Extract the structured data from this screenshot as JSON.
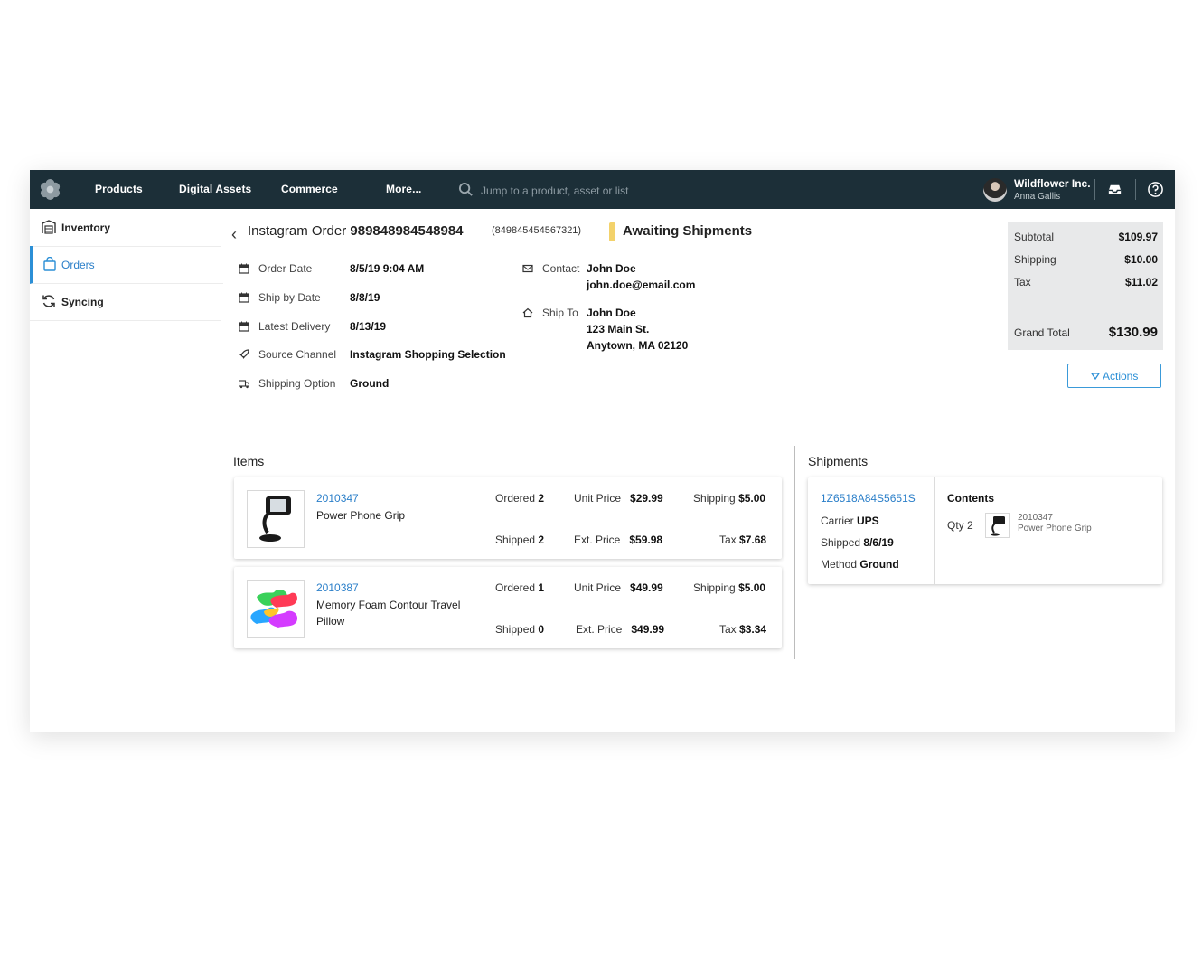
{
  "topbar": {
    "nav": [
      "Products",
      "Digital Assets",
      "Commerce",
      "More..."
    ],
    "search_placeholder": "Jump to a product, asset or list",
    "org_name": "Wildflower Inc.",
    "user_name": "Anna Gallis"
  },
  "sidebar": {
    "items": [
      {
        "label": "Inventory",
        "icon": "warehouse-icon",
        "active": false
      },
      {
        "label": "Orders",
        "icon": "shopping-bag-icon",
        "active": true
      },
      {
        "label": "Syncing",
        "icon": "sync-icon",
        "active": false
      }
    ]
  },
  "order": {
    "title_prefix": "Instagram Order",
    "number": "989848984548984",
    "alt_number": "(849845454567321)",
    "status": "Awaiting Shipments",
    "status_color": "#f3d26b",
    "details": [
      {
        "label": "Order Date",
        "value": "8/5/19 9:04 AM",
        "icon": "calendar-icon"
      },
      {
        "label": "Ship by Date",
        "value": "8/8/19",
        "icon": "calendar-icon"
      },
      {
        "label": "Latest Delivery",
        "value": "8/13/19",
        "icon": "calendar-icon"
      },
      {
        "label": "Source Channel",
        "value": "Instagram Shopping Selection",
        "icon": "rocket-icon"
      },
      {
        "label": "Shipping Option",
        "value": "Ground",
        "icon": "truck-icon"
      }
    ],
    "contact": {
      "label": "Contact",
      "name": "John Doe",
      "email": "john.doe@email.com"
    },
    "ship_to": {
      "label": "Ship To",
      "name": "John Doe",
      "address1": "123 Main St.",
      "address2": "Anytown, MA 02120"
    }
  },
  "summary": {
    "subtotal_label": "Subtotal",
    "subtotal": "$109.97",
    "shipping_label": "Shipping",
    "shipping": "$10.00",
    "tax_label": "Tax",
    "tax": "$11.02",
    "grand_total_label": "Grand Total",
    "grand_total": "$130.99"
  },
  "actions_label": "Actions",
  "items_title": "Items",
  "items": [
    {
      "sku": "2010347",
      "name": "Power Phone Grip",
      "ordered_label": "Ordered",
      "ordered": "2",
      "shipped_label": "Shipped",
      "shipped": "2",
      "unit_price_label": "Unit Price",
      "unit_price": "$29.99",
      "ext_price_label": "Ext. Price",
      "ext_price": "$59.98",
      "shipping_label": "Shipping",
      "shipping": "$5.00",
      "tax_label": "Tax",
      "tax": "$7.68"
    },
    {
      "sku": "2010387",
      "name": "Memory Foam Contour Travel Pillow",
      "ordered_label": "Ordered",
      "ordered": "1",
      "shipped_label": "Shipped",
      "shipped": "0",
      "unit_price_label": "Unit Price",
      "unit_price": "$49.99",
      "ext_price_label": "Ext. Price",
      "ext_price": "$49.99",
      "shipping_label": "Shipping",
      "shipping": "$5.00",
      "tax_label": "Tax",
      "tax": "$3.34"
    }
  ],
  "shipments_title": "Shipments",
  "shipment": {
    "tracking": "1Z6518A84S5651S",
    "carrier_label": "Carrier",
    "carrier": "UPS",
    "shipped_label": "Shipped",
    "shipped": "8/6/19",
    "method_label": "Method",
    "method": "Ground",
    "contents_label": "Contents",
    "qty_label": "Qty",
    "qty": "2",
    "content_sku": "2010347",
    "content_name": "Power Phone Grip"
  },
  "colors": {
    "topbar": "#1c2f38",
    "accent": "#2b8fd6",
    "link": "#2b7fc9",
    "summary_bg": "#e8e9ea"
  }
}
